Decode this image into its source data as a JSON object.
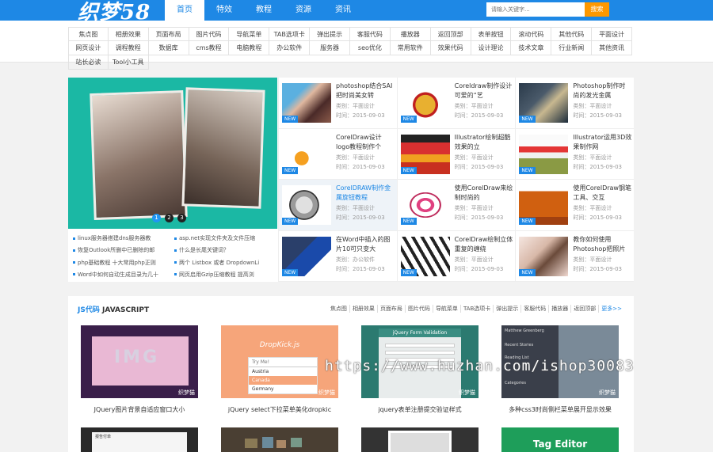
{
  "logo": "织梦58",
  "nav": [
    "首页",
    "特效",
    "教程",
    "资源",
    "资讯"
  ],
  "search": {
    "placeholder": "请输入关键字...",
    "button": "搜索"
  },
  "categories": [
    "焦点图",
    "相册效果",
    "页面布局",
    "图片代码",
    "导航菜单",
    "TAB选项卡",
    "弹出提示",
    "客服代码",
    "播放器",
    "返回顶部",
    "表单按钮",
    "滚动代码",
    "其他代码",
    "平面设计",
    "网页设计",
    "调程教程",
    "数据库",
    "cms教程",
    "电脑教程",
    "办公软件",
    "服务器",
    "seo优化",
    "常用软件",
    "效果代码",
    "设计理论",
    "技术文章",
    "行业新闻",
    "其他资讯",
    "站长必读",
    "Tool小工具"
  ],
  "slider_dots": [
    "1",
    "2",
    "3"
  ],
  "news": [
    "linux服务器搭建dns服务器教",
    "asp.net实现文件夹及文件压缩",
    "恢复Outlook所删中已删除的邮",
    "什么是长尾关键词？",
    "php基础教程 十大常用php正则",
    "两个 Listbox 或者 DropdownLi",
    "Word中如何自动生成目录为几十",
    "网页启用Gzip压缩教程 提高浏"
  ],
  "new_badge": "NEW",
  "cards": [
    {
      "title": "photoshop结合SAI把时尚美女转",
      "category": "类别：平面设计",
      "date": "时间：2015-09-03"
    },
    {
      "title": "Coreldraw制作设计可爱的“艺",
      "category": "类别：平面设计",
      "date": "时间：2015-09-03"
    },
    {
      "title": "Photoshop制作时尚的发光金属",
      "category": "类别：平面设计",
      "date": "时间：2015-09-03"
    },
    {
      "title": "CorelDraw设计logo教程制作个",
      "category": "类别：平面设计",
      "date": "时间：2015-09-03"
    },
    {
      "title": "Illustrator绘制超酷效果的立",
      "category": "类别：平面设计",
      "date": "时间：2015-09-03"
    },
    {
      "title": "Illustrator运用3D效果制作网",
      "category": "类别：平面设计",
      "date": "时间：2015-09-03"
    },
    {
      "title": "CorelDRAW制作金属旋钮教程",
      "category": "类别：平面设计",
      "date": "时间：2015-09-03"
    },
    {
      "title": "使用CorelDraw来绘制时尚的",
      "category": "类别：平面设计",
      "date": "时间：2015-09-03"
    },
    {
      "title": "使用CorelDraw钢笔工具、交互",
      "category": "类别：平面设计",
      "date": "时间：2015-09-03"
    },
    {
      "title": "在Word中插入的图片10可只变大",
      "category": "类别：办公软件",
      "date": "时间：2015-09-03"
    },
    {
      "title": "CorelDraw绘制立体重复的缠绕",
      "category": "类别：平面设计",
      "date": "时间：2015-09-03"
    },
    {
      "title": "教你如何使用Photoshop把照片",
      "category": "类别：平面设计",
      "date": "时间：2015-09-03"
    }
  ],
  "js_section": {
    "title_accent": "JS代码",
    "title": "JAVASCRIPT",
    "tags": [
      "焦点图",
      "相册效果",
      "页面布局",
      "图片代码",
      "导航菜单",
      "TAB选项卡",
      "弹出提示",
      "客服代码",
      "播放器",
      "返回顶部"
    ],
    "more": "更多>>",
    "watermark_small": "织梦猫",
    "items": [
      {
        "caption": "JQuery图片背景自适应窗口大小",
        "thumb_text": "IMG"
      },
      {
        "caption": "jQuery select下拉菜单美化dropkic",
        "thumb_text": "DropKick.js",
        "opt0": "Try Me!",
        "opt1": "Austria",
        "opt2": "Canada",
        "opt3": "Germany"
      },
      {
        "caption": "jquery表单注册提交验证样式",
        "thumb_text": "jQuery Form Validation"
      },
      {
        "caption": "多种css3时尚侧栏菜单展开显示效果",
        "thumb_text": "Matthew Greenberg",
        "l1": "Recent Stories",
        "l2": "Reading List",
        "l3": "Categories"
      }
    ],
    "row2": {
      "t1": "报告付单",
      "t4": "Tag Editor"
    }
  },
  "watermark": "https://www.huzhan.com/ishop30083"
}
